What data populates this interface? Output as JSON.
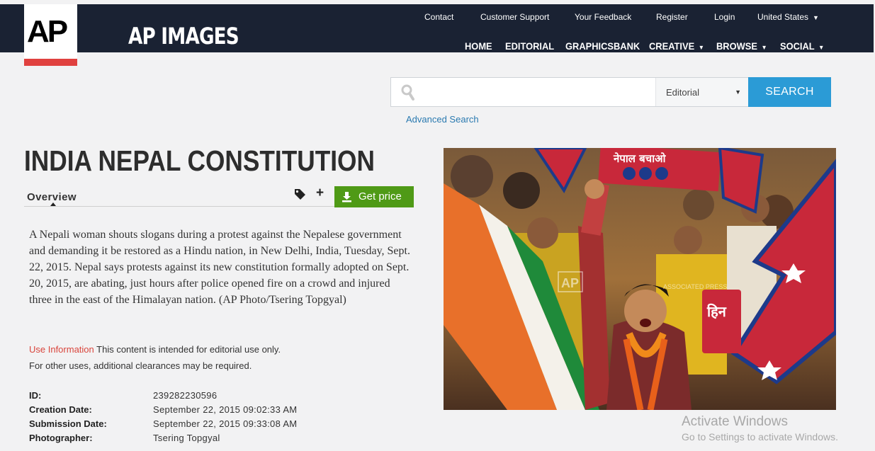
{
  "header": {
    "logo_text": "AP",
    "brand": "AP IMAGES",
    "utility_links": [
      "Contact",
      "Customer Support",
      "Your Feedback",
      "Register",
      "Login"
    ],
    "region": "United States",
    "nav": [
      "HOME",
      "EDITORIAL",
      "GRAPHICSBANK",
      "CREATIVE",
      "BROWSE",
      "SOCIAL"
    ],
    "colors": {
      "bar": "#1a2233",
      "logo_accent": "#e0413f"
    }
  },
  "search": {
    "placeholder": "",
    "value": "",
    "scope": "Editorial",
    "button": "SEARCH",
    "advanced": "Advanced Search",
    "button_color": "#2b9bd6"
  },
  "article": {
    "title": "INDIA NEPAL CONSTITUTION",
    "tab": "Overview",
    "get_price": "Get price",
    "description": "A Nepali woman shouts slogans during a protest against the Nepalese government and demanding it be restored as a Hindu nation, in New Delhi, India, Tuesday, Sept. 22, 2015. Nepal says protests against its new constitution formally adopted on Sept. 20, 2015, are abating, just hours after police opened fire on a crowd and injured three in the east of the Himalayan nation. (AP Photo/Tsering Topgyal)",
    "use_info_label": "Use Information",
    "use_info_text": "This content is intended for editorial use only.",
    "use_info_text2": "For other uses, additional clearances may be required.",
    "meta": [
      {
        "label": "ID:",
        "value": "239282230596"
      },
      {
        "label": "Creation Date:",
        "value": "September 22, 2015 09:02:33 AM"
      },
      {
        "label": "Submission Date:",
        "value": "September 22, 2015 09:33:08 AM"
      },
      {
        "label": "Photographer:",
        "value": "Tsering Topgyal"
      }
    ],
    "get_price_color": "#4f9a16"
  },
  "photo": {
    "watermark_logo": "AP",
    "watermark_text": "ASSOCIATED PRESS",
    "banner_text": "नेपाल बचाओ",
    "sign_text": "हिन"
  },
  "os_overlay": {
    "line1": "Activate Windows",
    "line2": "Go to Settings to activate Windows."
  }
}
